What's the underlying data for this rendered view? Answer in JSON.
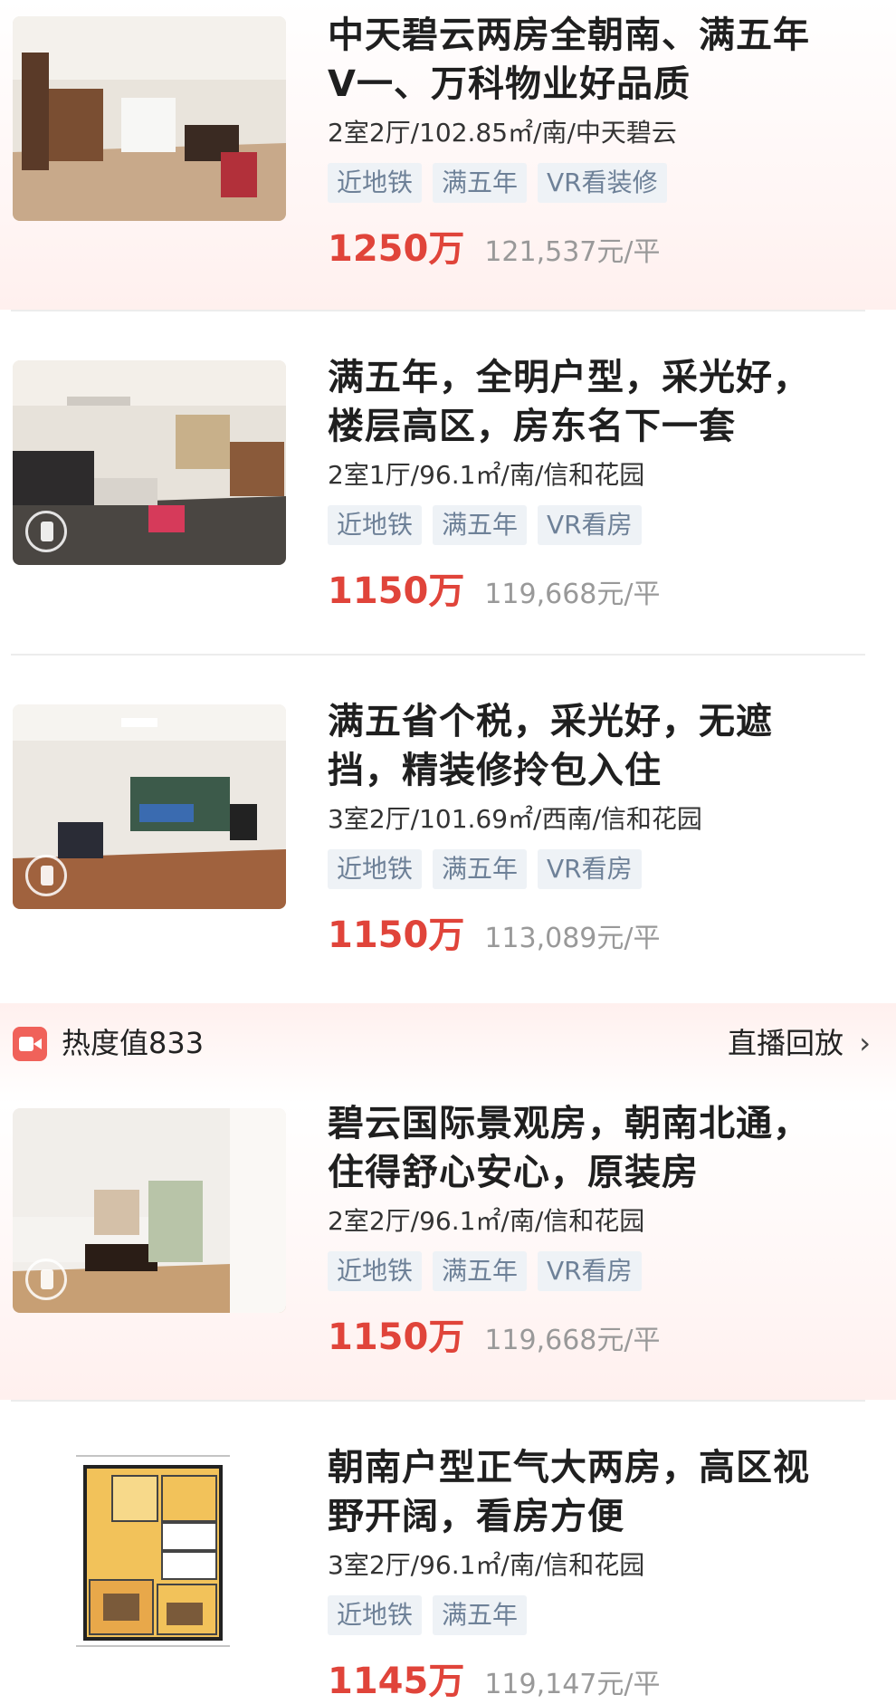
{
  "listings": [
    {
      "title_line1": "中天碧云两房全朝南、满五年",
      "title_line2": "V一、万科物业好品质",
      "meta": "2室2厅/102.85㎡/南/中天碧云",
      "tags": [
        "近地铁",
        "满五年",
        "VR看装修"
      ],
      "price": "1250万",
      "unit_price": "121,537元/平"
    },
    {
      "title_line1": "满五年，全明户型，采光好，",
      "title_line2": "楼层高区，房东名下一套",
      "meta": "2室1厅/96.1㎡/南/信和花园",
      "tags": [
        "近地铁",
        "满五年",
        "VR看房"
      ],
      "price": "1150万",
      "unit_price": "119,668元/平"
    },
    {
      "title_line1": "满五省个税，采光好，无遮",
      "title_line2": "挡，精装修拎包入住",
      "meta": "3室2厅/101.69㎡/西南/信和花园",
      "tags": [
        "近地铁",
        "满五年",
        "VR看房"
      ],
      "price": "1150万",
      "unit_price": "113,089元/平"
    },
    {
      "title_line1": "碧云国际景观房，朝南北通，",
      "title_line2": "住得舒心安心，原装房",
      "meta": "2室2厅/96.1㎡/南/信和花园",
      "tags": [
        "近地铁",
        "满五年",
        "VR看房"
      ],
      "price": "1150万",
      "unit_price": "119,668元/平"
    },
    {
      "title_line1": "朝南户型正气大两房，高区视",
      "title_line2": "野开阔，看房方便",
      "meta": "3室2厅/96.1㎡/南/信和花园",
      "tags": [
        "近地铁",
        "满五年"
      ],
      "price": "1145万",
      "unit_price": "119,147元/平"
    }
  ],
  "live": {
    "heat": "热度值833",
    "replay": "直播回放",
    "chevron": "›"
  },
  "colors": {
    "price": "#e0443a",
    "tag_bg": "#eef2f6",
    "tag_text": "#6e8198",
    "live_icon": "#f0625a"
  },
  "icons": [
    "video-camera-icon",
    "chevron-right-icon",
    "vr-view-icon"
  ]
}
